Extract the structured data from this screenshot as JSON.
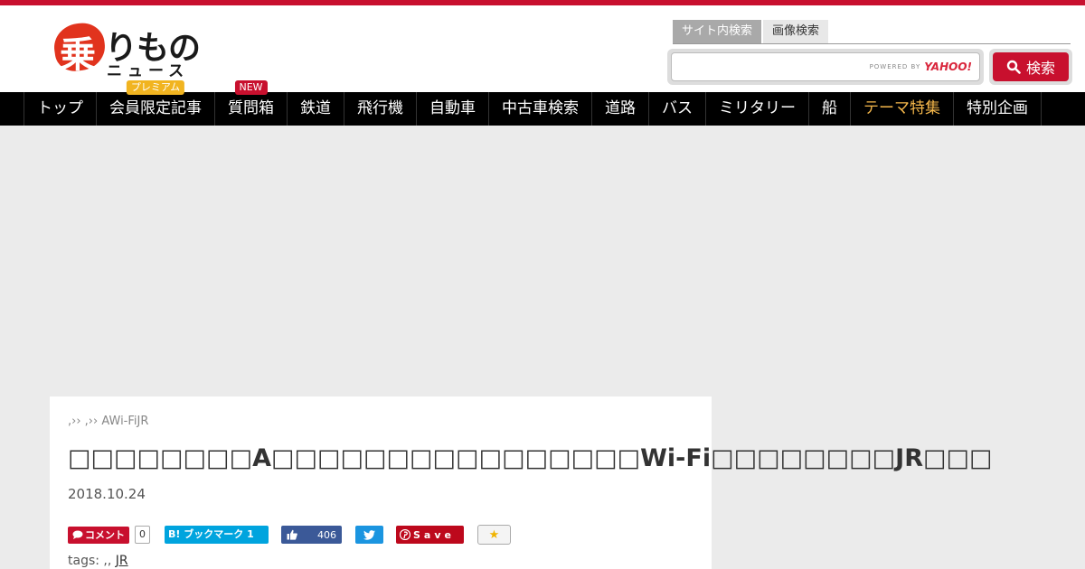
{
  "site": {
    "logo_kanji": "乗",
    "logo_kana": "りもの",
    "logo_sub": "ニュース"
  },
  "search": {
    "tabs": [
      "サイト内検索",
      "画像検索"
    ],
    "powered_by": "POWERED BY",
    "provider": "YAHOO!",
    "button_label": "検索"
  },
  "nav": {
    "items": [
      {
        "label": "トップ"
      },
      {
        "label": "会員限定記事",
        "badge": "プレミアム"
      },
      {
        "label": "質問箱",
        "badge": "NEW"
      },
      {
        "label": "鉄道"
      },
      {
        "label": "飛行機"
      },
      {
        "label": "自動車"
      },
      {
        "label": "中古車検索"
      },
      {
        "label": "道路"
      },
      {
        "label": "バス"
      },
      {
        "label": "ミリタリー"
      },
      {
        "label": "船"
      },
      {
        "label": "テーマ特集"
      },
      {
        "label": "特別企画"
      }
    ]
  },
  "article": {
    "breadcrumb": ",›› ,›› AWi-FiJR",
    "title": "□□□□□□□□A□□□□□□□□□□□□□□□□Wi-Fi□□□□□□□□JR□□□",
    "date": "2018.10.24",
    "share": {
      "comment_label": "コメント",
      "comment_count": "0",
      "hatena_label": "B! ブックマーク",
      "hatena_count": "1",
      "like_count": "406",
      "pin_label": "Save"
    },
    "tags_label": "tags:",
    "tags_sep": ",, ",
    "tag_link": "JR"
  },
  "colors": {
    "brand_red": "#c8102e",
    "nav_bg": "#000000",
    "highlight": "#f6b84b"
  }
}
